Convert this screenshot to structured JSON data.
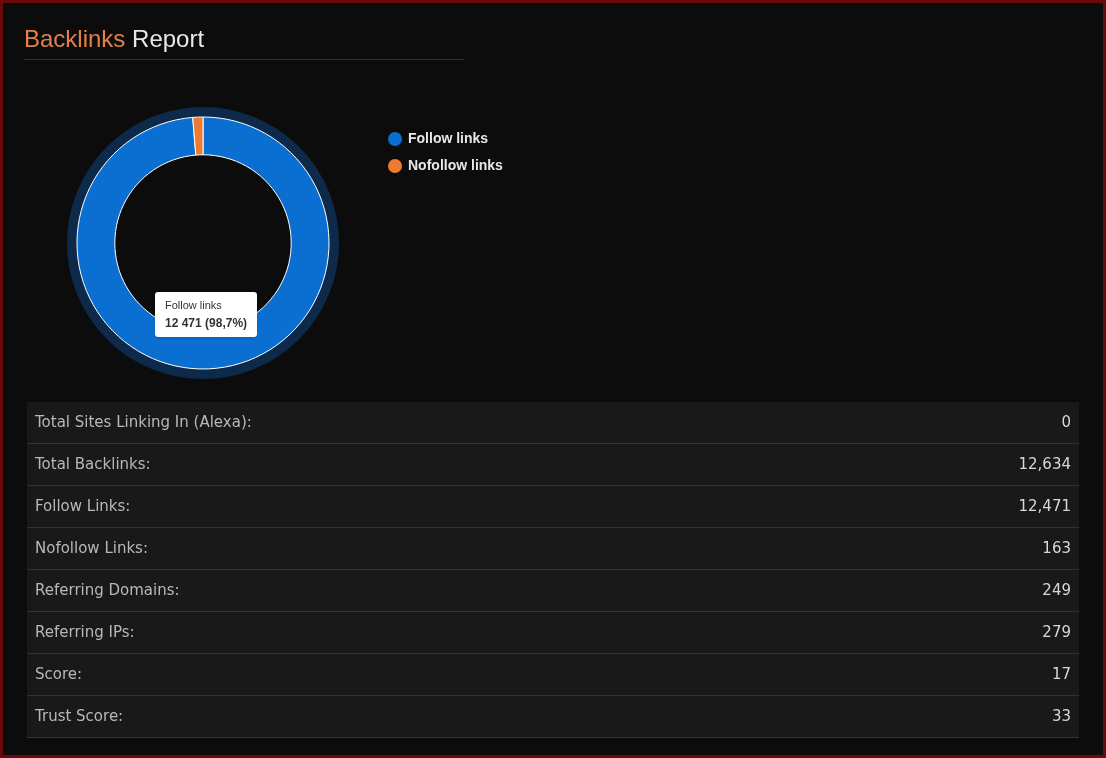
{
  "title": {
    "highlight": "Backlinks",
    "rest": "Report"
  },
  "chart_data": {
    "type": "donut",
    "categories": [
      "Follow links",
      "Nofollow links"
    ],
    "values": [
      98.7,
      1.3
    ],
    "colors": [
      "#0a6fd0",
      "#f07a30"
    ]
  },
  "tooltip": {
    "label": "Follow links",
    "value": "12 471 (98,7%)"
  },
  "stats": [
    {
      "label": "Total Sites Linking In (Alexa):",
      "value": "0"
    },
    {
      "label": "Total Backlinks:",
      "value": "12,634"
    },
    {
      "label": "Follow Links:",
      "value": "12,471"
    },
    {
      "label": "Nofollow Links:",
      "value": "163"
    },
    {
      "label": "Referring Domains:",
      "value": "249"
    },
    {
      "label": "Referring IPs:",
      "value": "279"
    },
    {
      "label": "Score:",
      "value": "17"
    },
    {
      "label": "Trust Score:",
      "value": "33"
    }
  ]
}
